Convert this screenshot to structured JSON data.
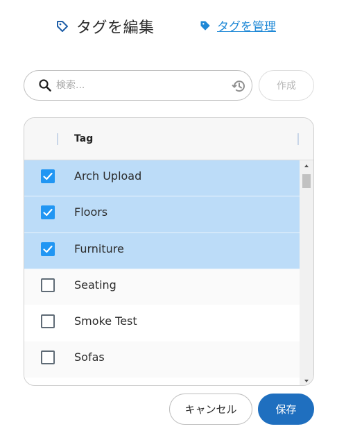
{
  "header": {
    "title": "タグを編集",
    "title_icon": "tag-outline-icon",
    "manage_link": "タグを管理",
    "manage_icon": "tag-filled-icon"
  },
  "search": {
    "placeholder": "検索...",
    "value": "",
    "search_icon": "search-icon",
    "history_icon": "history-icon"
  },
  "create_button": {
    "label": "作成",
    "enabled": false
  },
  "table": {
    "column_header": "Tag",
    "rows": [
      {
        "label": "Arch Upload",
        "checked": true
      },
      {
        "label": "Floors",
        "checked": true
      },
      {
        "label": "Furniture",
        "checked": true
      },
      {
        "label": "Seating",
        "checked": false
      },
      {
        "label": "Smoke Test",
        "checked": false
      },
      {
        "label": "Sofas",
        "checked": false
      }
    ]
  },
  "footer": {
    "cancel_label": "キャンセル",
    "save_label": "保存"
  },
  "colors": {
    "accent": "#1e88d6",
    "selected_row": "#bcdcf8",
    "checkbox": "#2196f3",
    "primary_button": "#1f6fbf"
  }
}
